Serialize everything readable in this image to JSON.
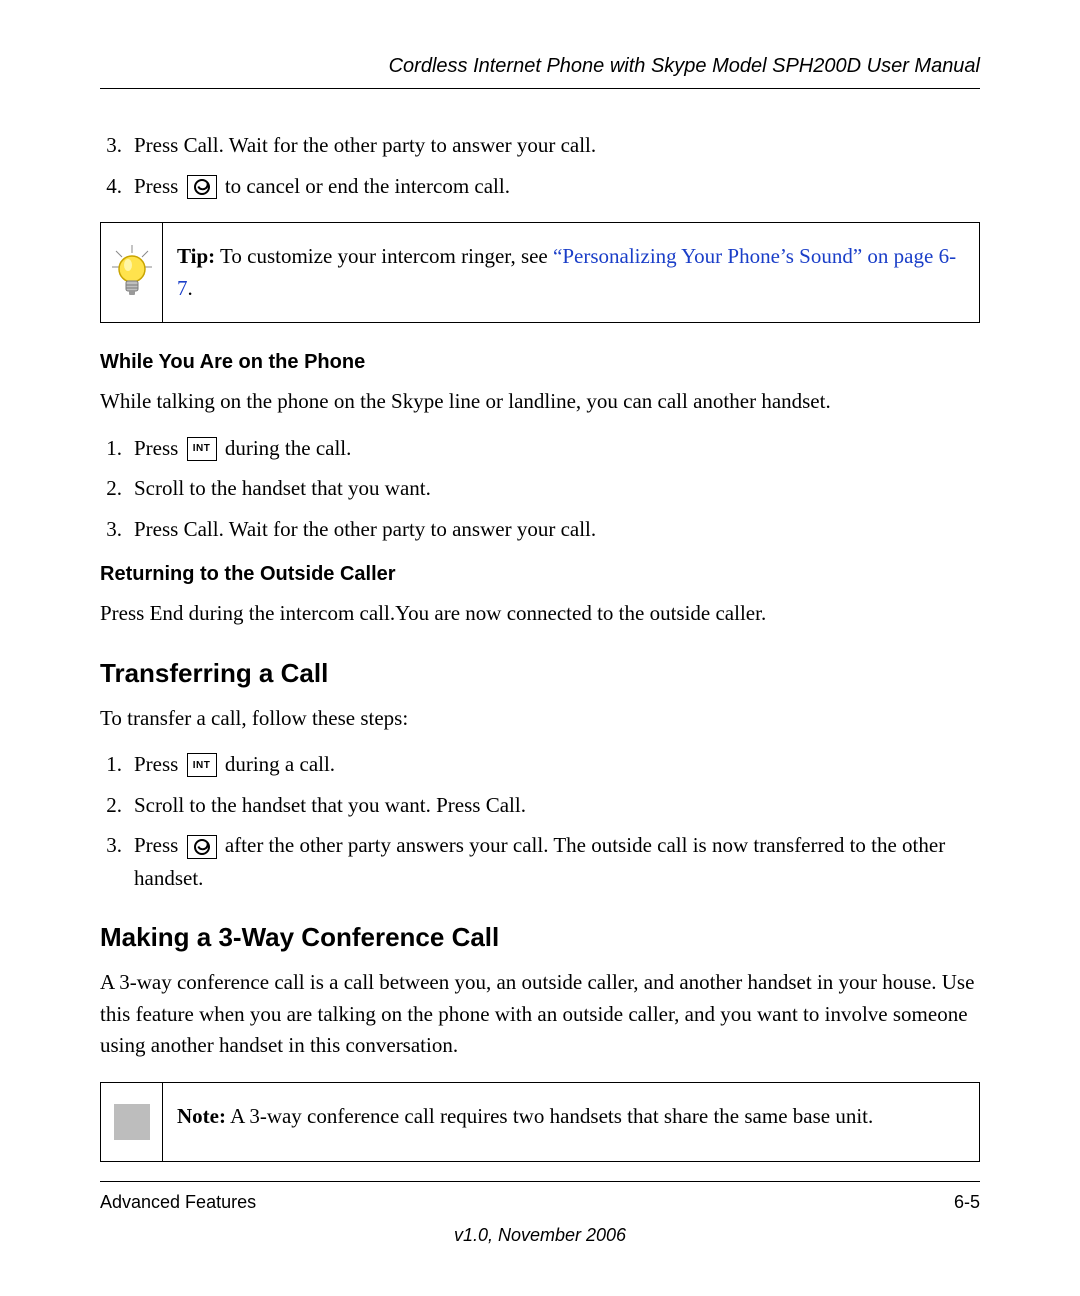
{
  "header": "Cordless Internet Phone with Skype Model SPH200D User Manual",
  "listA": {
    "item3": {
      "num": "3.",
      "text": "Press Call. Wait for the other party to answer your call."
    },
    "item4": {
      "num": "4.",
      "pre": "Press ",
      "post": " to cancel or end the intercom call."
    }
  },
  "tip": {
    "label": "Tip:",
    "text": " To customize your intercom ringer, see ",
    "link": "“Personalizing Your Phone’s Sound” on page 6-7",
    "after": "."
  },
  "sec1": {
    "heading": "While You Are on the Phone",
    "intro": "While talking on the phone on the Skype line or landline, you can call another handset.",
    "i1": {
      "num": "1.",
      "pre": "Press ",
      "post": " during the call."
    },
    "i2": {
      "num": "2.",
      "text": "Scroll to the handset that you want."
    },
    "i3": {
      "num": "3.",
      "text": "Press Call. Wait for the other party to answer your call."
    }
  },
  "sec2": {
    "heading": "Returning to the Outside Caller",
    "text": "Press End during the intercom call.You are now connected to the outside caller."
  },
  "sec3": {
    "heading": "Transferring a Call",
    "intro": "To transfer a call, follow these steps:",
    "i1": {
      "num": "1.",
      "pre": "Press ",
      "post": " during a call."
    },
    "i2": {
      "num": "2.",
      "text": "Scroll to the handset that you want. Press Call."
    },
    "i3": {
      "num": "3.",
      "pre": "Press ",
      "post": " after the other party answers your call. The outside call is now transferred to the other handset."
    }
  },
  "sec4": {
    "heading": "Making a 3-Way Conference Call",
    "text": "A 3-way conference call is a call between you, an outside caller, and another handset in your house. Use this feature when you are talking on the phone with an outside caller, and you want to involve someone using another handset in this conversation."
  },
  "note": {
    "label": "Note:",
    "text": " A 3-way conference call requires two handsets that share the same base unit."
  },
  "footer": {
    "left": "Advanced Features",
    "right": "6-5",
    "version": "v1.0, November 2006"
  },
  "icons": {
    "int": "INT"
  }
}
